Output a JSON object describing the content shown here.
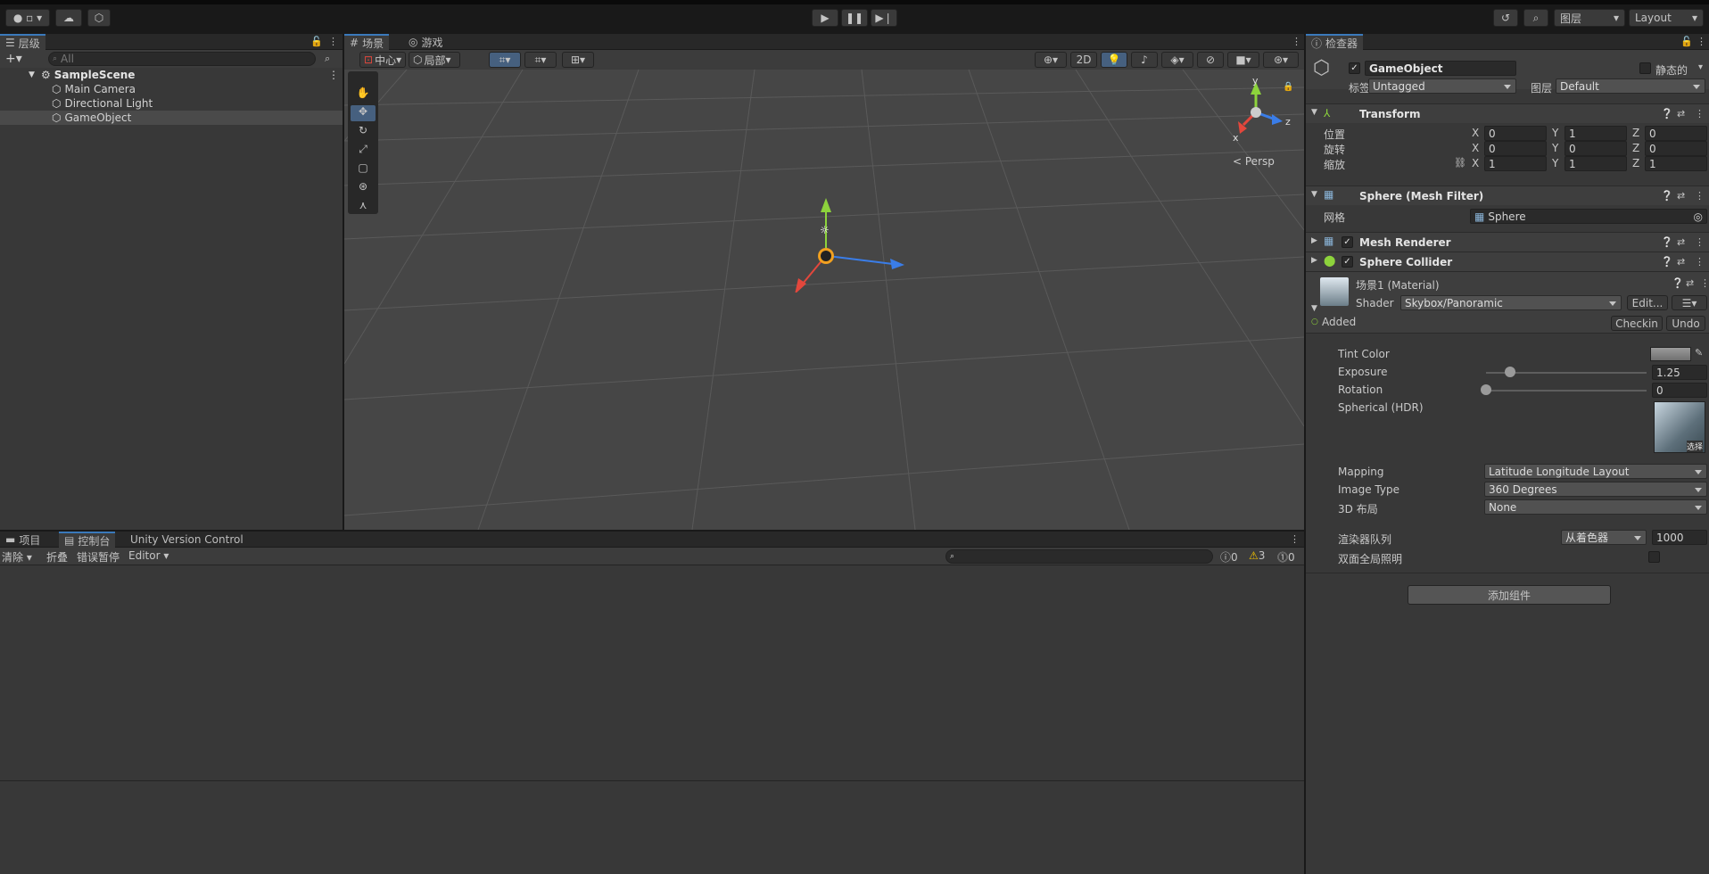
{
  "topbar": {
    "account_icon": "account-icon",
    "cloud_icon": "cloud-icon",
    "collab_icon": "package-icon",
    "play_icon": "play-icon",
    "pause_icon": "pause-icon",
    "step_icon": "step-icon",
    "layers_label": "图层",
    "layout_label": "Layout"
  },
  "hierarchy": {
    "tab": "层级",
    "search_placeholder": "All",
    "scene": "SampleScene",
    "items": [
      "Main Camera",
      "Directional Light",
      "GameObject"
    ]
  },
  "scene_view": {
    "tab_scene": "场景",
    "tab_game": "游戏",
    "pivot": "中心",
    "space": "局部",
    "two_d": "2D",
    "persp": "Persp",
    "axis_x": "x",
    "axis_y": "y",
    "axis_z": "z"
  },
  "bottom": {
    "tab_project": "项目",
    "tab_console": "控制台",
    "tab_uvc": "Unity Version Control",
    "clear": "清除",
    "collapse": "折叠",
    "error_pause": "错误暂停",
    "editor": "Editor",
    "count_log": "0",
    "count_warn": "3",
    "count_error": "0"
  },
  "inspector": {
    "tab": "检查器",
    "object_name": "GameObject",
    "static_label": "静态的",
    "tag_label": "标签",
    "tag_value": "Untagged",
    "layer_label": "图层",
    "layer_value": "Default",
    "transform": {
      "title": "Transform",
      "position": "位置",
      "rotation": "旋转",
      "scale": "缩放",
      "pos": [
        "0",
        "1",
        "0"
      ],
      "rot": [
        "0",
        "0",
        "0"
      ],
      "scl": [
        "1",
        "1",
        "1"
      ]
    },
    "mesh_filter": {
      "title": "Sphere (Mesh Filter)",
      "mesh_label": "网格",
      "mesh_value": "Sphere"
    },
    "mesh_renderer": "Mesh Renderer",
    "sphere_collider": "Sphere Collider",
    "material": {
      "title": "场景1 (Material)",
      "shader_label": "Shader",
      "shader_value": "Skybox/Panoramic",
      "edit": "Edit...",
      "added": "Added",
      "checkin": "Checkin",
      "undo": "Undo"
    },
    "props": {
      "tint": "Tint Color",
      "exposure": "Exposure",
      "exposure_value": "1.25",
      "exposure_level": 0.15,
      "rotation": "Rotation",
      "rotation_value": "0",
      "spherical": "Spherical  (HDR)",
      "select": "选择",
      "mapping": "Mapping",
      "mapping_value": "Latitude Longitude Layout",
      "image_type": "Image Type",
      "image_type_value": "360 Degrees",
      "layout3d": "3D 布局",
      "layout3d_value": "None",
      "render_queue": "渲染器队列",
      "render_queue_mode": "从着色器",
      "render_queue_value": "1000",
      "double_gi": "双面全局照明"
    },
    "add_component": "添加组件"
  },
  "colors": {
    "accent": "#3a79bb",
    "x_axis": "#e3473c",
    "y_axis": "#8dd33c",
    "z_axis": "#3a7de8"
  }
}
